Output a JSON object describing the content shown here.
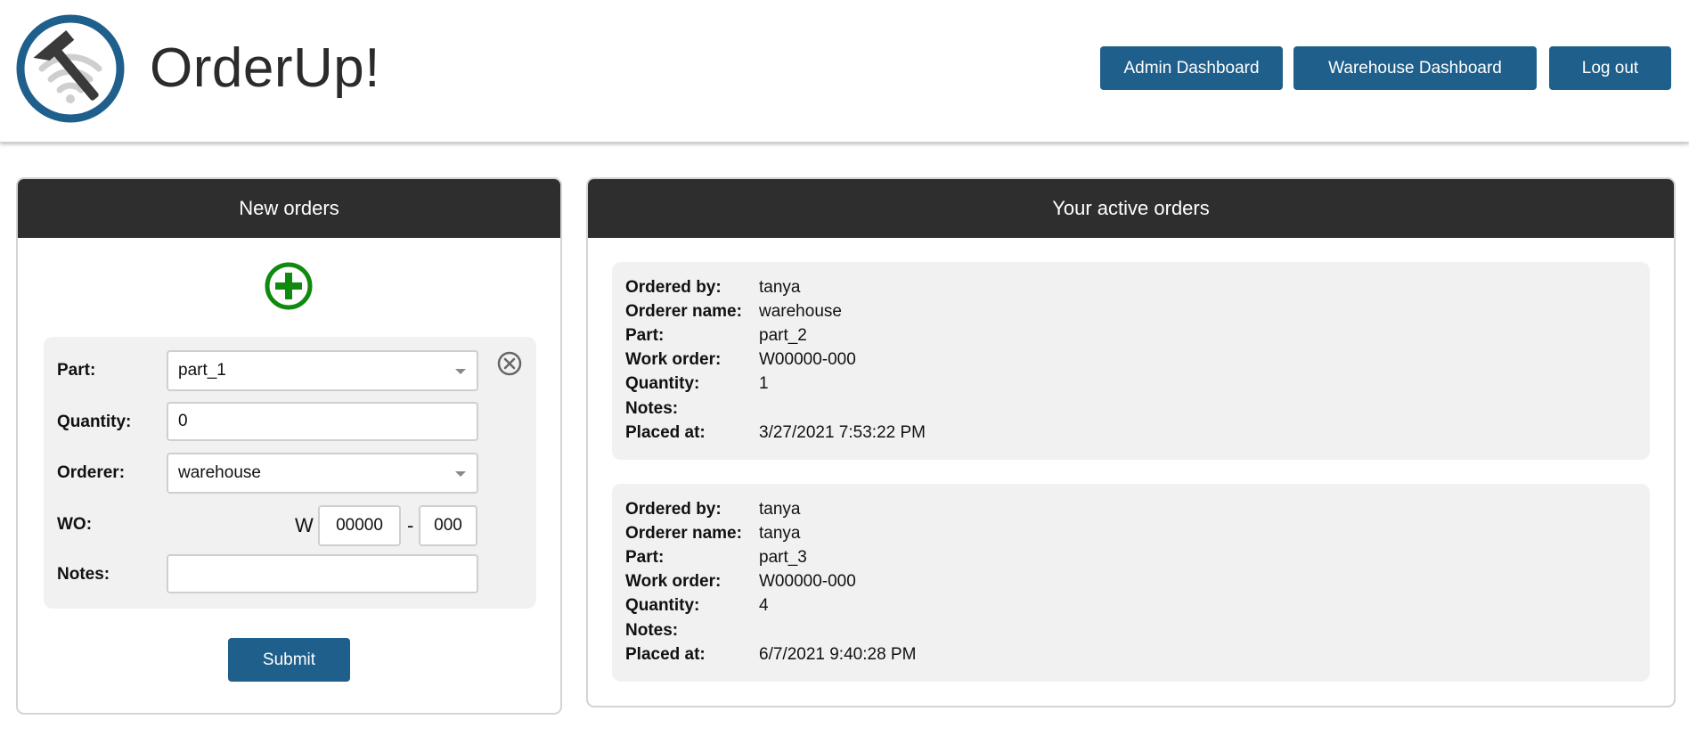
{
  "app": {
    "title": "OrderUp!",
    "logo_icon": "hammer-wifi-logo-icon"
  },
  "nav": {
    "admin_label": "Admin Dashboard",
    "warehouse_label": "Warehouse Dashboard",
    "logout_label": "Log out"
  },
  "colors": {
    "accent": "#1f5f8b",
    "header_dark": "#2e2e2e",
    "add_green": "#0f8a0f",
    "card_bg": "#f1f1f1"
  },
  "new_orders": {
    "heading": "New orders",
    "add_icon": "plus-circle-icon",
    "remove_icon": "close-circle-icon",
    "form": {
      "part_label": "Part:",
      "part_value": "part_1",
      "quantity_label": "Quantity:",
      "quantity_value": "0",
      "orderer_label": "Orderer:",
      "orderer_value": "warehouse",
      "wo_label": "WO:",
      "wo_prefix": "W",
      "wo_part1": "00000",
      "wo_sep": "-",
      "wo_part2": "000",
      "notes_label": "Notes:",
      "notes_value": ""
    },
    "submit_label": "Submit"
  },
  "active_orders": {
    "heading": "Your active orders",
    "labels": {
      "ordered_by": "Ordered by:",
      "orderer_name": "Orderer name:",
      "part": "Part:",
      "work_order": "Work order:",
      "quantity": "Quantity:",
      "notes": "Notes:",
      "placed_at": "Placed at:"
    },
    "orders": [
      {
        "ordered_by": "tanya",
        "orderer_name": "warehouse",
        "part": "part_2",
        "work_order": "W00000-000",
        "quantity": "1",
        "notes": "",
        "placed_at": "3/27/2021 7:53:22 PM"
      },
      {
        "ordered_by": "tanya",
        "orderer_name": "tanya",
        "part": "part_3",
        "work_order": "W00000-000",
        "quantity": "4",
        "notes": "",
        "placed_at": "6/7/2021 9:40:28 PM"
      }
    ]
  }
}
